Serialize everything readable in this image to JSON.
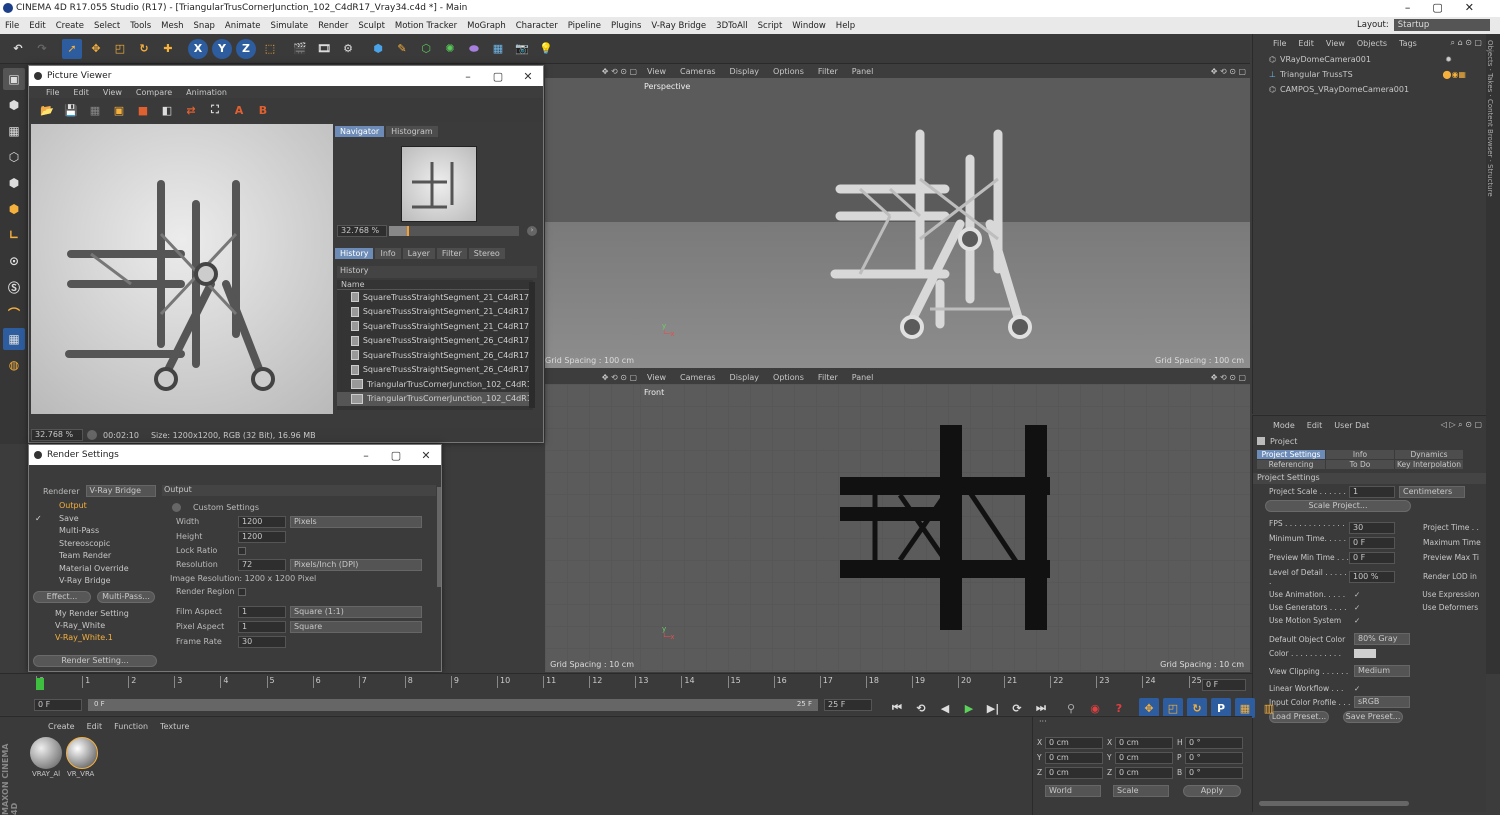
{
  "app": {
    "title": "CINEMA 4D R17.055 Studio (R17) - [TriangularTrusCornerJunction_102_C4dR17_Vray34.c4d *] - Main",
    "layout_label": "Layout:",
    "layout_value": "Startup"
  },
  "menu": [
    "File",
    "Edit",
    "Create",
    "Select",
    "Tools",
    "Mesh",
    "Snap",
    "Animate",
    "Simulate",
    "Render",
    "Sculpt",
    "Motion Tracker",
    "MoGraph",
    "Character",
    "Pipeline",
    "Plugins",
    "V-Ray Bridge",
    "3DToAll",
    "Script",
    "Window",
    "Help"
  ],
  "toolbar": {
    "axes": [
      "X",
      "Y",
      "Z"
    ]
  },
  "viewport_top": {
    "menu": [
      "View",
      "Cameras",
      "Display",
      "Options",
      "Filter",
      "Panel"
    ],
    "label": "Perspective",
    "grid_spacing": "Grid Spacing : 100 cm",
    "grid_spacing_left": "Grid Spacing : 100 cm"
  },
  "viewport_bottom": {
    "menu": [
      "View",
      "Cameras",
      "Display",
      "Options",
      "Filter",
      "Panel"
    ],
    "label": "Front",
    "grid_spacing": "Grid Spacing : 10 cm",
    "grid_spacing_left": "Grid Spacing : 10 cm"
  },
  "picture_viewer": {
    "title": "Picture Viewer",
    "menu": [
      "File",
      "Edit",
      "View",
      "Compare",
      "Animation"
    ],
    "tabs": [
      "Navigator",
      "Histogram"
    ],
    "zoom": "32.768 %",
    "info_tabs": [
      "History",
      "Info",
      "Layer",
      "Filter",
      "Stereo"
    ],
    "history_title": "History",
    "col_name": "Name",
    "history": [
      "SquareTrussStraightSegment_21_C4dR17_",
      "SquareTrussStraightSegment_21_C4dR17_",
      "SquareTrussStraightSegment_21_C4dR17_",
      "SquareTrussStraightSegment_26_C4dR17_",
      "SquareTrussStraightSegment_26_C4dR17_",
      "SquareTrussStraightSegment_26_C4dR17_",
      "TriangularTrusCornerJunction_102_C4dR1",
      "TriangularTrusCornerJunction_102_C4dR1"
    ],
    "status_zoom": "32.768 %",
    "status_time": "00:02:10",
    "status_size": "Size: 1200x1200, RGB (32 Bit), 16.96 MB"
  },
  "render_settings": {
    "title": "Render Settings",
    "renderer_label": "Renderer",
    "renderer": "V-Ray Bridge",
    "items": [
      "Output",
      "Save",
      "Multi-Pass",
      "Stereoscopic",
      "Team Render",
      "Material Override",
      "V-Ray Bridge"
    ],
    "effect_btn": "Effect...",
    "multipass_btn": "Multi-Pass...",
    "presets": [
      "My Render Setting",
      "V-Ray_White",
      "V-Ray_White.1"
    ],
    "render_setting_btn": "Render Setting...",
    "section": "Output",
    "custom": "Custom Settings",
    "width_label": "Width",
    "width": "1200",
    "height_label": "Height",
    "height": "1200",
    "unit": "Pixels",
    "lock_ratio": "Lock Ratio",
    "resolution_label": "Resolution",
    "resolution": "72",
    "res_unit": "Pixels/Inch (DPI)",
    "image_res": "Image Resolution: 1200 x 1200 Pixel",
    "render_region": "Render Region",
    "film_aspect_label": "Film Aspect",
    "film_aspect": "1",
    "film_aspect_preset": "Square (1:1)",
    "pixel_aspect_label": "Pixel Aspect",
    "pixel_aspect": "1",
    "pixel_aspect_preset": "Square",
    "frame_rate_label": "Frame Rate",
    "frame_rate": "30"
  },
  "objects": {
    "menu": [
      "File",
      "Edit",
      "View",
      "Objects",
      "Tags"
    ],
    "items": [
      "VRayDomeCamera001",
      "Triangular TrussTS",
      "CAMPOS_VRayDomeCamera001"
    ]
  },
  "attributes": {
    "menu": [
      "Mode",
      "Edit",
      "User Dat"
    ],
    "object": "Project",
    "tabs": [
      "Project Settings",
      "Info",
      "Dynamics",
      "Referencing",
      "To Do",
      "Key Interpolation"
    ],
    "section": "Project Settings",
    "project_scale_label": "Project Scale . . . . . .",
    "project_scale": "1",
    "project_scale_unit": "Centimeters",
    "scale_btn": "Scale Project...",
    "fps_label": "FPS . . . . . . . . . . . . . .",
    "fps": "30",
    "project_time_label": "Project Time . .",
    "min_time_label": "Minimum Time. . . . . .",
    "min_time": "0 F",
    "max_time_label": "Maximum Time",
    "prev_min_label": "Preview Min Time . . .",
    "prev_min": "0 F",
    "prev_max_label": "Preview Max Ti",
    "lod_label": "Level of Detail . . . . . .",
    "lod": "100 %",
    "render_lod_label": "Render LOD in",
    "use_anim": "Use Animation. . . . .",
    "use_expr": "Use Expression",
    "use_gen": "Use Generators . . . .",
    "use_def": "Use Deformers",
    "use_motion": "Use Motion System",
    "def_color_label": "Default Object Color",
    "def_color": "80% Gray",
    "color_label": "Color . . . . . . . . . . .",
    "view_clip_label": "View Clipping . . . . . .",
    "view_clip": "Medium",
    "linear_label": "Linear Workflow . . .",
    "input_profile_label": "Input Color Profile . . .",
    "input_profile": "sRGB",
    "load_preset": "Load Preset...",
    "save_preset": "Save Preset..."
  },
  "timeline": {
    "ticks": [
      "0",
      "1",
      "2",
      "3",
      "4",
      "5",
      "6",
      "7",
      "8",
      "9",
      "10",
      "11",
      "12",
      "13",
      "14",
      "15",
      "16",
      "17",
      "18",
      "19",
      "20",
      "21",
      "22",
      "23",
      "24",
      "25"
    ],
    "end_frame": "0 F",
    "start": "0 F",
    "range_start": "0 F",
    "range_end": "25 F",
    "end": "25 F"
  },
  "materials": {
    "menu": [
      "Create",
      "Edit",
      "Function",
      "Texture"
    ],
    "items": [
      "VRAY_Al",
      "VR_VRA"
    ]
  },
  "coords": {
    "rows": [
      [
        "X",
        "0 cm",
        "X",
        "0 cm",
        "H",
        "0 °"
      ],
      [
        "Y",
        "0 cm",
        "Y",
        "0 cm",
        "P",
        "0 °"
      ],
      [
        "Z",
        "0 cm",
        "Z",
        "0 cm",
        "B",
        "0 °"
      ]
    ],
    "world": "World",
    "scale": "Scale",
    "apply": "Apply"
  },
  "brand": "MAXON CINEMA 4D"
}
